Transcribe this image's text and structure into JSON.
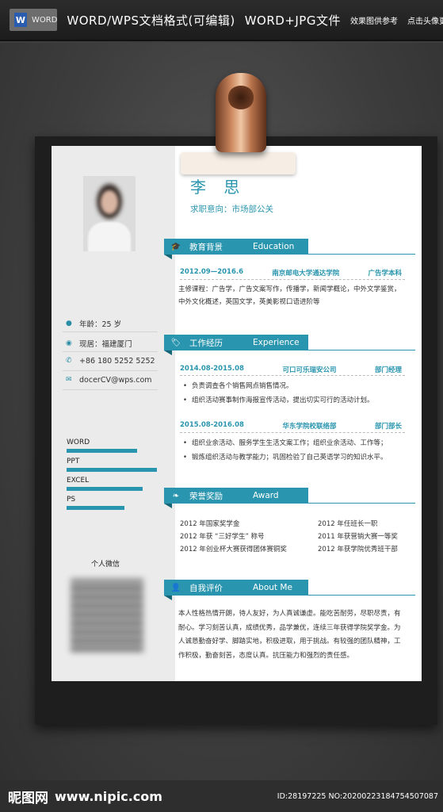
{
  "banner": {
    "word_badge": "WORD",
    "title": "WORD/WPS文档格式(可编辑)",
    "file_type": "WORD+JPG文件",
    "note": "效果图供参考",
    "right_hint": "点击头像更多"
  },
  "resume": {
    "name": "李 思",
    "intent": "求职意向：市场部公关",
    "info": [
      {
        "icon": "user-icon",
        "text": "年龄：25 岁"
      },
      {
        "icon": "location-icon",
        "text": "现居：福建厦门"
      },
      {
        "icon": "phone-icon",
        "text": "+86 180 5252 5252"
      },
      {
        "icon": "mail-icon",
        "text": "docerCV@wps.com"
      }
    ],
    "skills": [
      {
        "name": "WORD",
        "level": 0.74
      },
      {
        "name": "PPT",
        "level": 0.95
      },
      {
        "name": "EXCEL",
        "level": 0.8
      },
      {
        "name": "PS",
        "level": 0.61
      }
    ],
    "wechat_label": "个人微信",
    "sections": {
      "education": {
        "cn": "教育背景",
        "en": "Education",
        "period": "2012.09—2016.6",
        "school": "南京邮电大学通达学院",
        "major": "广告学本科",
        "courses_line1": "主修课程：广告学，广告文案写作，传播学，新闻学概论，中外文学鉴赏，",
        "courses_line2": "中外文化概述，英国文学，英美影视口语进阶等"
      },
      "experience": {
        "cn": "工作经历",
        "en": "Experience",
        "job1": {
          "period": "2014.08-2015.08",
          "company": "可口可乐瑞安公司",
          "role": "部门经理",
          "bullets": [
            "负责调查各个销售网点销售情况。",
            "组织活动赛事制作海报宣传活动，提出切实可行的活动计划。"
          ]
        },
        "job2": {
          "period": "2015.08-2016.08",
          "company": "华东学院校联络部",
          "role": "部门部长",
          "bullets": [
            "组织业余活动、服务学生生活文案工作；组织业余活动、工作等；",
            "锻炼组织活动与教学能力；巩固检验了自己英语学习的知识水平。"
          ]
        }
      },
      "awards": {
        "cn": "荣誉奖励",
        "en": "Award",
        "items": [
          "2012 年国家奖学金",
          "2012 年任班长一职",
          "2012 年获 “三好学生” 称号",
          "2011 年获营销大赛一等奖",
          "2012 年创业杯大赛获得团体赛铜奖",
          "2012 年获学院优秀班干部"
        ]
      },
      "self": {
        "cn": "自我评价",
        "en": "About Me",
        "lines": [
          "本人性格热情开朗，待人友好，为人真诚谦虚。能吃苦耐劳，尽职尽责，有",
          "耐心。学习刻苦认真，成绩优秀，品学兼优，连续三年获得学院奖学金。为",
          "人诚恳勤奋好学、脚踏实地，积极进取，用于挑战。有较强的团队精神，工",
          "作积极，勤奋刻苦，态度认真。抗压能力和强烈的责任感。"
        ]
      }
    }
  },
  "footer": {
    "logo": "昵图网",
    "site": "www.nipic.com",
    "id": "ID:28197225 NO:20200223184754507087"
  },
  "colors": {
    "accent": "#2a95ae",
    "dark_fold": "#166577",
    "board": "#1e1e1e"
  }
}
